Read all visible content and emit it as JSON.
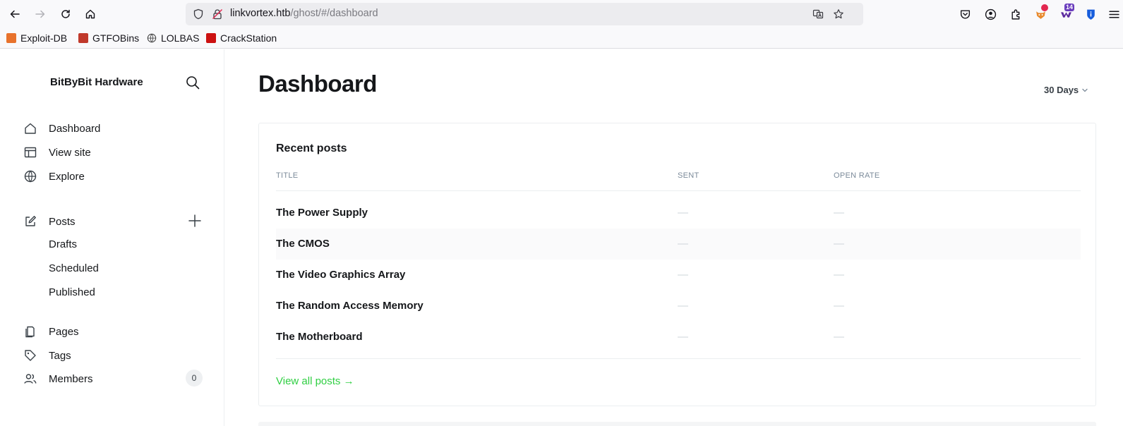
{
  "browser": {
    "url_host": "linkvortex.htb",
    "url_path": "/ghost/#/dashboard",
    "extensions": {
      "badge_count": "14"
    },
    "bookmarks": [
      {
        "label": "Exploit-DB",
        "color": "#e8722c"
      },
      {
        "label": "GTFOBins",
        "color": "#c0392b"
      },
      {
        "label": "LOLBAS",
        "color": "#444444"
      },
      {
        "label": "CrackStation",
        "color": "#cc1111"
      }
    ]
  },
  "sidebar": {
    "site_title": "BitByBit Hardware",
    "nav": [
      {
        "label": "Dashboard",
        "icon": "home-icon"
      },
      {
        "label": "View site",
        "icon": "layout-icon"
      },
      {
        "label": "Explore",
        "icon": "globe-icon"
      }
    ],
    "posts": {
      "label": "Posts",
      "sub": [
        "Drafts",
        "Scheduled",
        "Published"
      ]
    },
    "nav2": [
      {
        "label": "Pages",
        "icon": "pages-icon"
      },
      {
        "label": "Tags",
        "icon": "tag-icon"
      },
      {
        "label": "Members",
        "icon": "members-icon",
        "count": "0"
      }
    ]
  },
  "main": {
    "title": "Dashboard",
    "range": "30 Days",
    "recent_posts": {
      "title": "Recent posts",
      "columns": [
        "TITLE",
        "SENT",
        "OPEN RATE"
      ],
      "rows": [
        {
          "title": "The Power Supply",
          "sent": "—",
          "open_rate": "—"
        },
        {
          "title": "The CMOS",
          "sent": "—",
          "open_rate": "—"
        },
        {
          "title": "The Video Graphics Array",
          "sent": "—",
          "open_rate": "—"
        },
        {
          "title": "The Random Access Memory",
          "sent": "—",
          "open_rate": "—"
        },
        {
          "title": "The Motherboard",
          "sent": "—",
          "open_rate": "—"
        }
      ],
      "view_all": "View all posts →"
    }
  },
  "colors": {
    "accent_green": "#30cf43",
    "text_dark": "#15171a",
    "muted": "#7c8b9a"
  }
}
